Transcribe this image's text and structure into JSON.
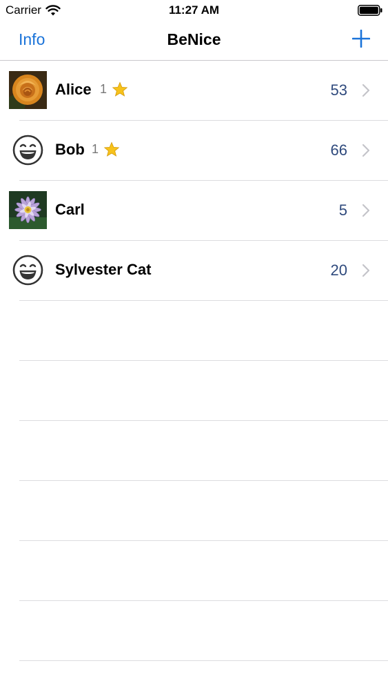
{
  "status_bar": {
    "carrier": "Carrier",
    "time": "11:27 AM",
    "wifi_icon": "wifi-icon",
    "battery_icon": "battery-icon"
  },
  "nav": {
    "left_button": "Info",
    "title": "BeNice",
    "right_icon": "plus-icon"
  },
  "colors": {
    "accent": "#1a73d9",
    "score_text": "#2f4a7d",
    "badge_text": "#777777",
    "separator": "#dcdcdf"
  },
  "people": [
    {
      "name": "Alice",
      "badge": "1",
      "has_star": true,
      "score": "53",
      "avatar": "rose-photo"
    },
    {
      "name": "Bob",
      "badge": "1",
      "has_star": true,
      "score": "66",
      "avatar": "smiley-icon"
    },
    {
      "name": "Carl",
      "badge": "",
      "has_star": false,
      "score": "5",
      "avatar": "water-lily-photo"
    },
    {
      "name": "Sylvester Cat",
      "badge": "",
      "has_star": false,
      "score": "20",
      "avatar": "smiley-icon"
    }
  ]
}
